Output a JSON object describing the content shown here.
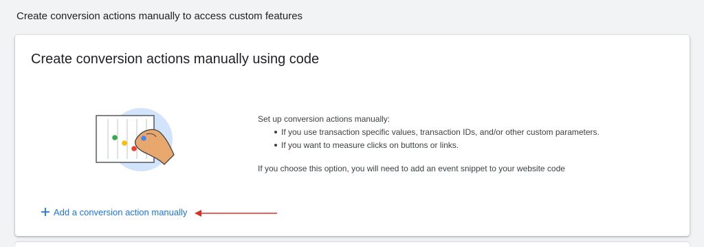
{
  "section": {
    "heading": "Create conversion actions manually to access custom features"
  },
  "card": {
    "title": "Create conversion actions manually using code",
    "intro": "Set up conversion actions manually:",
    "bullets": [
      "If you use transaction specific values, transaction IDs, and/or other custom parameters.",
      "If you want to measure clicks on buttons or links."
    ],
    "note": "If you choose this option, you will need to add an event snippet to your website code",
    "add_link_label": "Add a conversion action manually",
    "add_icon": "plus-icon",
    "illustration_icon": "sliders-hand-illustration"
  },
  "colors": {
    "link": "#1a73e8",
    "annotation_arrow": "#d93025",
    "illustration_circle": "#d2e3fc",
    "dot_green": "#34a853",
    "dot_yellow": "#fbbc04",
    "dot_red": "#ea4335",
    "dot_blue": "#4285f4"
  }
}
